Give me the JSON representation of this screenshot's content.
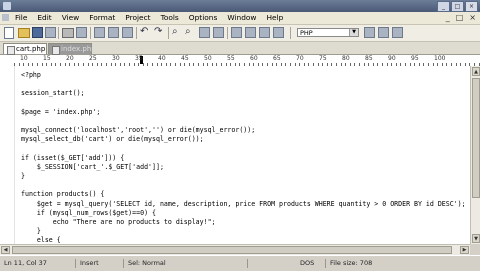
{
  "window": {
    "controls": [
      "_",
      "□",
      "×"
    ]
  },
  "menu": {
    "items": [
      "File",
      "Edit",
      "View",
      "Format",
      "Project",
      "Tools",
      "Options",
      "Window",
      "Help"
    ],
    "right_controls": [
      "_",
      "□",
      "×"
    ]
  },
  "toolbar": {
    "language_select": "PHP"
  },
  "tabs": [
    {
      "label": "cart.php"
    },
    {
      "label": "index.php"
    }
  ],
  "ruler": {
    "labels": [
      "10",
      "15",
      "20",
      "25",
      "30",
      "35",
      "40",
      "45",
      "50",
      "55",
      "60",
      "65",
      "70",
      "75",
      "80",
      "85",
      "90",
      "95",
      "100"
    ]
  },
  "code_lines": [
    "<?php",
    "",
    "session_start();",
    "",
    "$page = 'index.php';",
    "",
    "mysql_connect('localhost','root','') or die(mysql_error());",
    "mysql_select_db('cart') or die(mysql_error());",
    "",
    "if (isset($_GET['add'])) {",
    "    $_SESSION['cart_'.$_GET['add']];",
    "}",
    "",
    "function products() {",
    "    $get = mysql_query('SELECT id, name, description, price FROM products WHERE quantity > 0 ORDER BY id DESC');",
    "    if (mysql_num_rows($get)==0) {",
    "        echo \"There are no products to display!\";",
    "    }",
    "    else {"
  ],
  "status": {
    "position": "Ln 11, Col 37",
    "mode": "Insert",
    "selection": "Sel: Normal",
    "format": "DOS",
    "file_size": "File size: 708"
  }
}
